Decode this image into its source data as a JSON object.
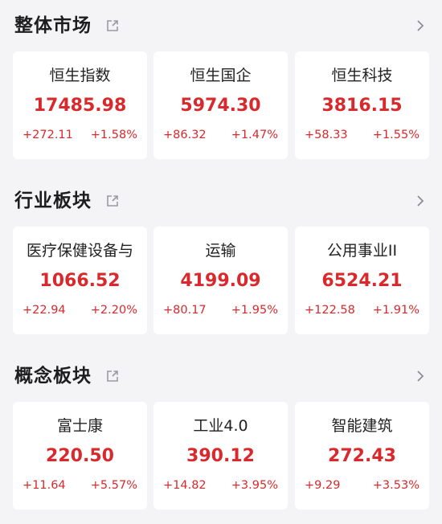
{
  "sections": [
    {
      "title": "整体市场",
      "cards": [
        {
          "name": "恒生指数",
          "price": "17485.98",
          "change": "+272.11",
          "percent": "+1.58%"
        },
        {
          "name": "恒生国企",
          "price": "5974.30",
          "change": "+86.32",
          "percent": "+1.47%"
        },
        {
          "name": "恒生科技",
          "price": "3816.15",
          "change": "+58.33",
          "percent": "+1.55%"
        }
      ]
    },
    {
      "title": "行业板块",
      "cards": [
        {
          "name": "医疗保健设备与",
          "price": "1066.52",
          "change": "+22.94",
          "percent": "+2.20%"
        },
        {
          "name": "运输",
          "price": "4199.09",
          "change": "+80.17",
          "percent": "+1.95%"
        },
        {
          "name": "公用事业II",
          "price": "6524.21",
          "change": "+122.58",
          "percent": "+1.91%"
        }
      ]
    },
    {
      "title": "概念板块",
      "cards": [
        {
          "name": "富士康",
          "price": "220.50",
          "change": "+11.64",
          "percent": "+5.57%"
        },
        {
          "name": "工业4.0",
          "price": "390.12",
          "change": "+14.82",
          "percent": "+3.95%"
        },
        {
          "name": "智能建筑",
          "price": "272.43",
          "change": "+9.29",
          "percent": "+3.53%"
        }
      ]
    }
  ],
  "icons": {
    "share": "share-out-icon",
    "more": "chevron-right-icon"
  },
  "colors": {
    "up": "#d9292c",
    "title": "#1d1d1f",
    "background": "#f4f4f6",
    "card": "#ffffff"
  }
}
